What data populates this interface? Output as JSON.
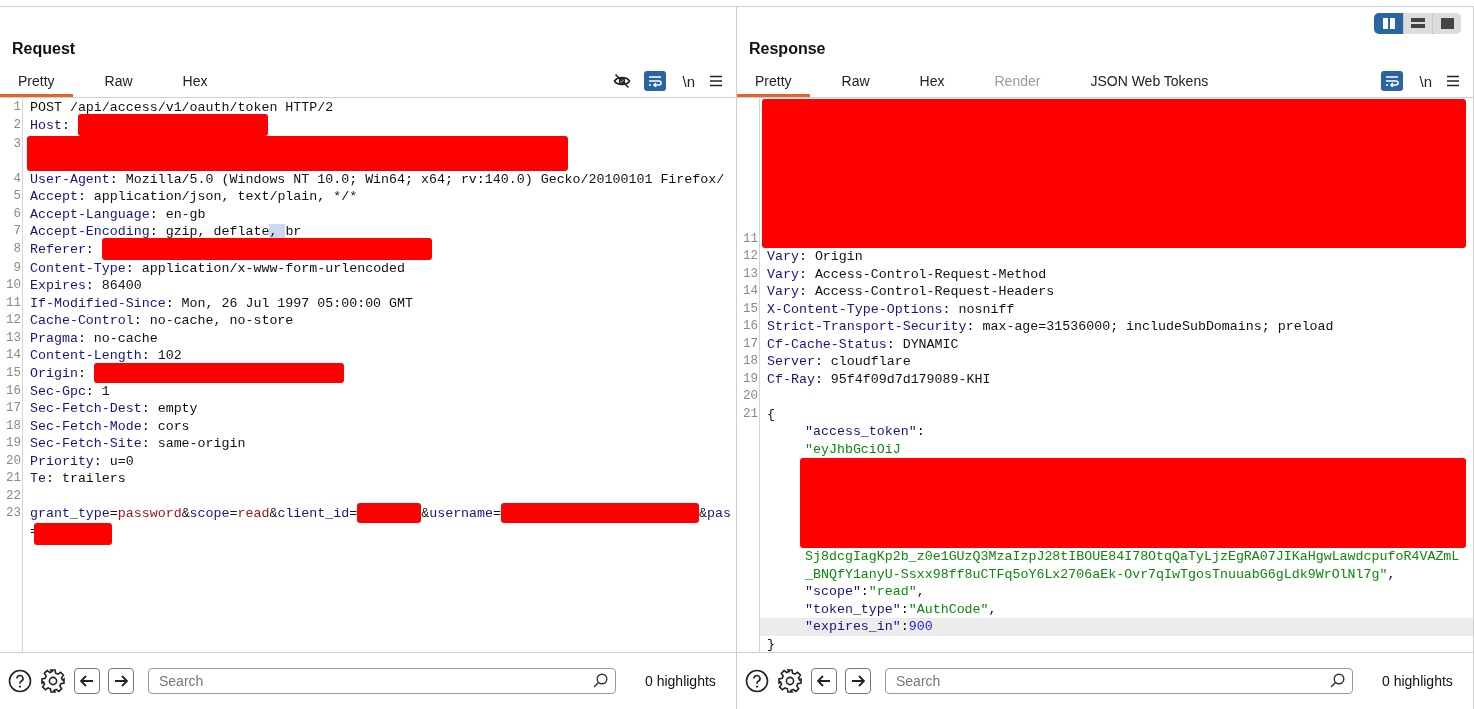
{
  "panes": [
    {
      "title": "Request",
      "tabs": [
        {
          "label": "Pretty",
          "selected": true,
          "disabled": false
        },
        {
          "label": "Raw",
          "selected": false,
          "disabled": false
        },
        {
          "label": "Hex",
          "selected": false,
          "disabled": false
        }
      ],
      "tools": [
        {
          "kind": "hide"
        },
        {
          "kind": "wrap",
          "on": true
        },
        {
          "kind": "newline",
          "label": "\\n"
        },
        {
          "kind": "menu"
        }
      ],
      "lines": [
        {
          "num": "1",
          "kind": "line",
          "current": false,
          "parts": [
            {
              "kind": "plain",
              "text": "POST /api/access/v1/oauth/token HTTP/2"
            }
          ]
        },
        {
          "num": "2",
          "kind": "line",
          "current": false,
          "parts": [
            {
              "kind": "key",
              "text": "Host"
            },
            {
              "kind": "plain",
              "text": ": "
            },
            {
              "kind": "redacted"
            }
          ]
        },
        {
          "num": "3",
          "kind": "line",
          "current": false,
          "parts": [
            {
              "kind": "redacted"
            }
          ]
        },
        {
          "num": "4",
          "kind": "line",
          "current": false,
          "parts": [
            {
              "kind": "key",
              "text": "User-Agent"
            },
            {
              "kind": "plain",
              "text": ": Mozilla/5.0 (Windows NT 10.0; Win64; x64; rv:140.0) Gecko/20100101 Firefox/"
            }
          ]
        },
        {
          "num": "5",
          "kind": "line",
          "current": false,
          "parts": [
            {
              "kind": "key",
              "text": "Accept"
            },
            {
              "kind": "plain",
              "text": ": application/json, text/plain, */*"
            }
          ]
        },
        {
          "num": "6",
          "kind": "line",
          "current": false,
          "parts": [
            {
              "kind": "key",
              "text": "Accept-Language"
            },
            {
              "kind": "plain",
              "text": ": en-gb"
            }
          ]
        },
        {
          "num": "7",
          "kind": "line",
          "current": false,
          "parts": [
            {
              "kind": "key",
              "text": "Accept-Encoding"
            },
            {
              "kind": "plain",
              "text": ": gzip, deflate"
            },
            {
              "kind": "sel",
              "text": ", "
            },
            {
              "kind": "plain",
              "text": "br"
            }
          ]
        },
        {
          "num": "8",
          "kind": "line",
          "current": false,
          "parts": [
            {
              "kind": "key",
              "text": "Referer"
            },
            {
              "kind": "plain",
              "text": ": "
            },
            {
              "kind": "redacted"
            }
          ]
        },
        {
          "num": "9",
          "kind": "line",
          "current": false,
          "parts": [
            {
              "kind": "key",
              "text": "Content-Type"
            },
            {
              "kind": "plain",
              "text": ": application/x-www-form-urlencoded"
            }
          ]
        },
        {
          "num": "10",
          "kind": "line",
          "current": false,
          "parts": [
            {
              "kind": "key",
              "text": "Expires"
            },
            {
              "kind": "plain",
              "text": ": 86400"
            }
          ]
        },
        {
          "num": "11",
          "kind": "line",
          "current": false,
          "parts": [
            {
              "kind": "key",
              "text": "If-Modified-Since"
            },
            {
              "kind": "plain",
              "text": ": Mon, 26 Jul 1997 05:00:00 GMT"
            }
          ]
        },
        {
          "num": "12",
          "kind": "line",
          "current": false,
          "parts": [
            {
              "kind": "key",
              "text": "Cache-Control"
            },
            {
              "kind": "plain",
              "text": ": no-cache, no-store"
            }
          ]
        },
        {
          "num": "13",
          "kind": "line",
          "current": false,
          "parts": [
            {
              "kind": "key",
              "text": "Pragma"
            },
            {
              "kind": "plain",
              "text": ": no-cache"
            }
          ]
        },
        {
          "num": "14",
          "kind": "line",
          "current": false,
          "parts": [
            {
              "kind": "key",
              "text": "Content-Length"
            },
            {
              "kind": "plain",
              "text": ": 102"
            }
          ]
        },
        {
          "num": "15",
          "kind": "line",
          "current": false,
          "parts": [
            {
              "kind": "key",
              "text": "Origin"
            },
            {
              "kind": "plain",
              "text": ": "
            },
            {
              "kind": "redacted"
            }
          ]
        },
        {
          "num": "16",
          "kind": "line",
          "current": false,
          "parts": [
            {
              "kind": "key",
              "text": "Sec-Gpc"
            },
            {
              "kind": "plain",
              "text": ": 1"
            }
          ]
        },
        {
          "num": "17",
          "kind": "line",
          "current": false,
          "parts": [
            {
              "kind": "key",
              "text": "Sec-Fetch-Dest"
            },
            {
              "kind": "plain",
              "text": ": empty"
            }
          ]
        },
        {
          "num": "18",
          "kind": "line",
          "current": false,
          "parts": [
            {
              "kind": "key",
              "text": "Sec-Fetch-Mode"
            },
            {
              "kind": "plain",
              "text": ": cors"
            }
          ]
        },
        {
          "num": "19",
          "kind": "line",
          "current": false,
          "parts": [
            {
              "kind": "key",
              "text": "Sec-Fetch-Site"
            },
            {
              "kind": "plain",
              "text": ": same-origin"
            }
          ]
        },
        {
          "num": "20",
          "kind": "line",
          "current": false,
          "parts": [
            {
              "kind": "key",
              "text": "Priority"
            },
            {
              "kind": "plain",
              "text": ": u=0"
            }
          ]
        },
        {
          "num": "21",
          "kind": "line",
          "current": false,
          "parts": [
            {
              "kind": "key",
              "text": "Te"
            },
            {
              "kind": "plain",
              "text": ": trailers"
            }
          ]
        },
        {
          "num": "22",
          "kind": "line",
          "current": false
        },
        {
          "num": "23",
          "kind": "line",
          "current": false,
          "parts": [
            {
              "kind": "key",
              "text": "grant_type"
            },
            {
              "kind": "plain",
              "text": "="
            },
            {
              "kind": "value",
              "text": "password"
            },
            {
              "kind": "plain",
              "text": "&"
            },
            {
              "kind": "key",
              "text": "scope"
            },
            {
              "kind": "plain",
              "text": "="
            },
            {
              "kind": "value",
              "text": "read"
            },
            {
              "kind": "plain",
              "text": "&"
            },
            {
              "kind": "key",
              "text": "client_id"
            },
            {
              "kind": "plain",
              "text": "="
            },
            {
              "kind": "redacted"
            },
            {
              "kind": "plain",
              "text": "&"
            },
            {
              "kind": "key",
              "text": "username"
            },
            {
              "kind": "plain",
              "text": "="
            },
            {
              "kind": "redacted"
            },
            {
              "kind": "plain",
              "text": "&"
            },
            {
              "kind": "key",
              "text": "pas"
            }
          ]
        },
        {
          "kind": "wrap",
          "current": false,
          "parts": [
            {
              "kind": "plain",
              "text": "="
            },
            {
              "kind": "redacted"
            }
          ]
        }
      ],
      "search": {
        "placeholder": "Search"
      },
      "highlights": "0 highlights"
    },
    {
      "title": "Response",
      "layout_options": [
        {
          "kind": "columns",
          "selected": true
        },
        {
          "kind": "rows",
          "selected": false
        },
        {
          "kind": "single",
          "selected": false
        }
      ],
      "tabs": [
        {
          "label": "Pretty",
          "selected": true,
          "disabled": false
        },
        {
          "label": "Raw",
          "selected": false,
          "disabled": false
        },
        {
          "label": "Hex",
          "selected": false,
          "disabled": false
        },
        {
          "label": "Render",
          "selected": false,
          "disabled": true
        },
        {
          "label": "JSON Web Tokens",
          "selected": false,
          "disabled": false
        }
      ],
      "tools": [
        {
          "kind": "wrap",
          "on": true
        },
        {
          "kind": "newline",
          "label": "\\n"
        },
        {
          "kind": "menu"
        }
      ],
      "lines": [
        {
          "num": "11",
          "kind": "line",
          "current": false,
          "parts": [
            {
              "kind": "redacted"
            }
          ]
        },
        {
          "num": "12",
          "kind": "line",
          "current": false,
          "parts": [
            {
              "kind": "key",
              "text": "Vary"
            },
            {
              "kind": "plain",
              "text": ": Origin"
            }
          ]
        },
        {
          "num": "13",
          "kind": "line",
          "current": false,
          "parts": [
            {
              "kind": "key",
              "text": "Vary"
            },
            {
              "kind": "plain",
              "text": ": Access-Control-Request-Method"
            }
          ]
        },
        {
          "num": "14",
          "kind": "line",
          "current": false,
          "parts": [
            {
              "kind": "key",
              "text": "Vary"
            },
            {
              "kind": "plain",
              "text": ": Access-Control-Request-Headers"
            }
          ]
        },
        {
          "num": "15",
          "kind": "line",
          "current": false,
          "parts": [
            {
              "kind": "key",
              "text": "X-Content-Type-Options"
            },
            {
              "kind": "plain",
              "text": ": nosniff"
            }
          ]
        },
        {
          "num": "16",
          "kind": "line",
          "current": false,
          "parts": [
            {
              "kind": "key",
              "text": "Strict-Transport-Security"
            },
            {
              "kind": "plain",
              "text": ": max-age=31536000; includeSubDomains; preload"
            }
          ]
        },
        {
          "num": "17",
          "kind": "line",
          "current": false,
          "parts": [
            {
              "kind": "key",
              "text": "Cf-Cache-Status"
            },
            {
              "kind": "plain",
              "text": ": DYNAMIC"
            }
          ]
        },
        {
          "num": "18",
          "kind": "line",
          "current": false,
          "parts": [
            {
              "kind": "key",
              "text": "Server"
            },
            {
              "kind": "plain",
              "text": ": cloudflare"
            }
          ]
        },
        {
          "num": "19",
          "kind": "line",
          "current": false,
          "parts": [
            {
              "kind": "key",
              "text": "Cf-Ray"
            },
            {
              "kind": "plain",
              "text": ": 95f4f09d7d179089-KHI"
            }
          ]
        },
        {
          "num": "20",
          "kind": "line",
          "current": false
        },
        {
          "num": "21",
          "kind": "line",
          "current": false,
          "parts": [
            {
              "kind": "plain",
              "text": "{"
            }
          ]
        },
        {
          "kind": "json",
          "current": false,
          "parts": [
            {
              "kind": "key",
              "text": "\"access_token\""
            },
            {
              "kind": "plain",
              "text": ":"
            }
          ]
        },
        {
          "kind": "json",
          "current": false,
          "parts": [
            {
              "kind": "string",
              "text": "\"eyJhbGciOiJ"
            }
          ]
        },
        {
          "kind": "json",
          "current": false,
          "parts": [
            {
              "kind": "redacted"
            }
          ]
        },
        {
          "kind": "json",
          "current": false,
          "parts": [
            {
              "kind": "string",
              "text": "Sj8dcgIagKp2b_z0e1GUzQ3MzaIzpJ28tIBOUE84I78OtqQaTyLjzEgRA07JIKaHgwLawdcpufoR4VAZmL"
            }
          ]
        },
        {
          "kind": "json",
          "current": false,
          "parts": [
            {
              "kind": "string",
              "text": "_BNQfY1anyU-Ssxx98ff8uCTFq5oY6Lx2706aEk-Ovr7qIwTgosTnuuabG6gLdk9WrOlNl7g\""
            },
            {
              "kind": "plain",
              "text": ","
            }
          ]
        },
        {
          "kind": "json",
          "current": false,
          "parts": [
            {
              "kind": "key",
              "text": "\"scope\""
            },
            {
              "kind": "plain",
              "text": ":"
            },
            {
              "kind": "string",
              "text": "\"read\""
            },
            {
              "kind": "plain",
              "text": ","
            }
          ]
        },
        {
          "kind": "json",
          "current": false,
          "parts": [
            {
              "kind": "key",
              "text": "\"token_type\""
            },
            {
              "kind": "plain",
              "text": ":"
            },
            {
              "kind": "string",
              "text": "\"AuthCode\""
            },
            {
              "kind": "plain",
              "text": ","
            }
          ]
        },
        {
          "kind": "json",
          "current": true,
          "parts": [
            {
              "kind": "key",
              "text": "\"expires_in\""
            },
            {
              "kind": "plain",
              "text": ":"
            },
            {
              "kind": "number",
              "text": "900"
            }
          ]
        },
        {
          "kind": "wrap",
          "current": false,
          "parts": [
            {
              "kind": "plain",
              "text": "}"
            }
          ]
        }
      ],
      "search": {
        "placeholder": "Search"
      },
      "highlights": "0 highlights"
    }
  ]
}
